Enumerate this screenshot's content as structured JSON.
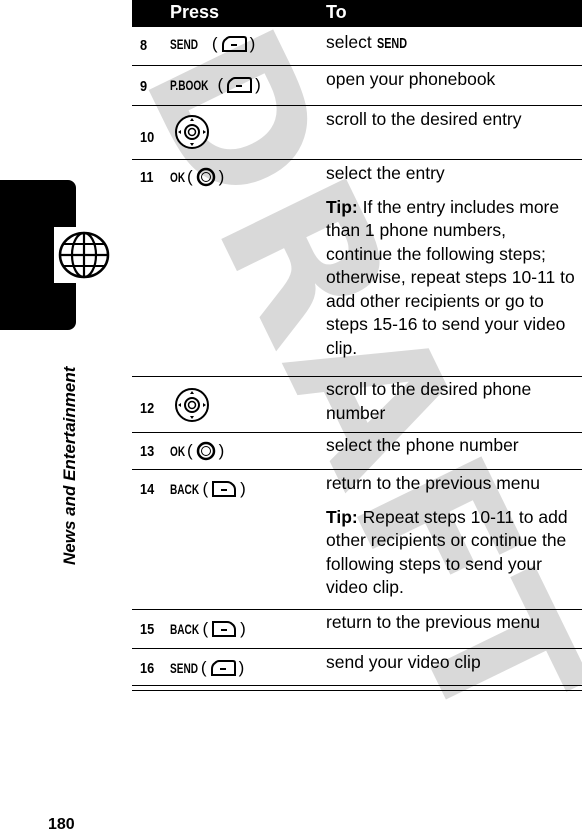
{
  "watermark": "DRAFT",
  "section": {
    "label": "News and Entertainment",
    "icon": "globe-icon"
  },
  "page_number": "180",
  "table": {
    "headers": {
      "press": "Press",
      "to": "To"
    },
    "rows": [
      {
        "step": "8",
        "key": "SEND",
        "icon": "left-soft-key-icon",
        "to": "select ",
        "to_key": "SEND"
      },
      {
        "step": "9",
        "key": "P.BOOK",
        "icon": "left-soft-key-icon",
        "to": "open your phonebook"
      },
      {
        "step": "10",
        "key": "",
        "icon": "navigation-key-icon",
        "to": "scroll to the desired entry"
      },
      {
        "step": "11",
        "key": "OK",
        "icon": "center-select-key-icon",
        "to": "select the entry",
        "tip_label": "Tip:",
        "tip": " If the entry includes more than 1 phone numbers, continue the following steps; otherwise, repeat steps 10-11 to add other recipients or go to steps 15-16 to send your video clip."
      },
      {
        "step": "12",
        "key": "",
        "icon": "navigation-key-icon",
        "to": "scroll to the desired phone number"
      },
      {
        "step": "13",
        "key": "OK",
        "icon": "center-select-key-icon",
        "to": "select the phone number"
      },
      {
        "step": "14",
        "key": "BACK",
        "icon": "right-soft-key-icon",
        "to": "return to the previous menu",
        "tip_label": "Tip:",
        "tip": " Repeat steps 10-11 to add other recipients or continue the following steps to send your video clip."
      },
      {
        "step": "15",
        "key": "BACK",
        "icon": "right-soft-key-icon",
        "to": "return to the previous menu"
      },
      {
        "step": "16",
        "key": "SEND",
        "icon": "left-soft-key-icon",
        "to": "send your video clip"
      }
    ]
  }
}
